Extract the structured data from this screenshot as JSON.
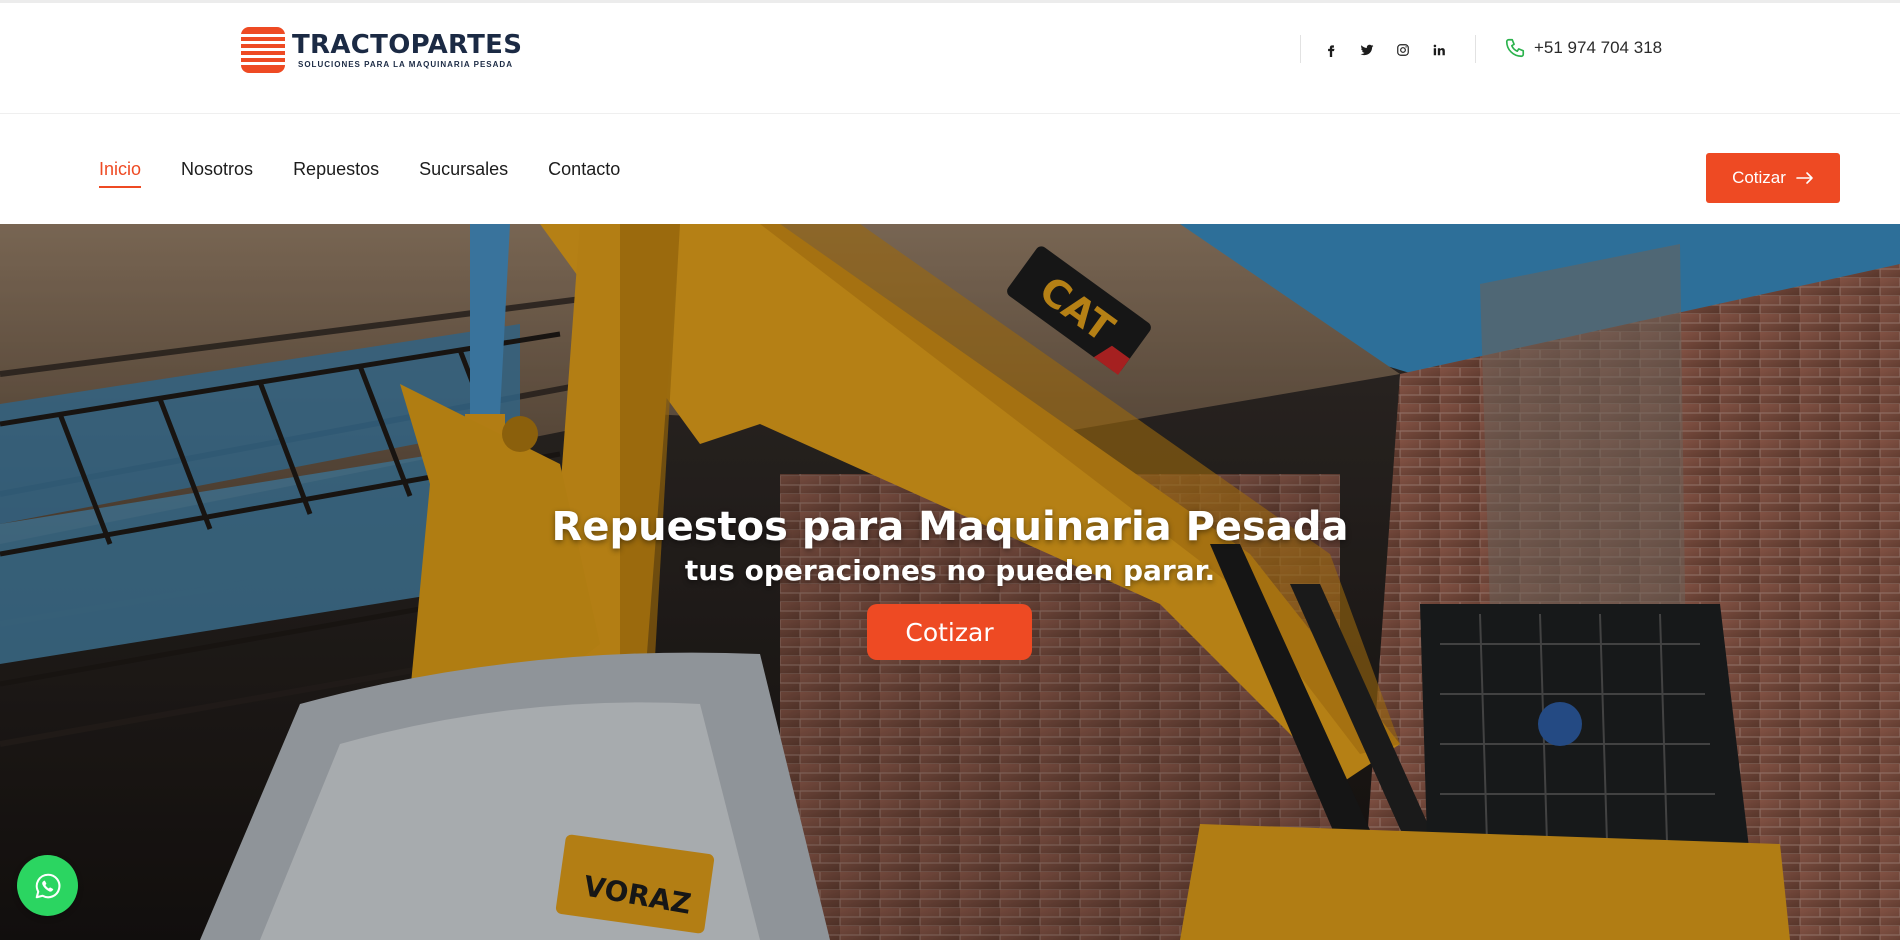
{
  "brand": {
    "name": "TRACTOPARTES",
    "tagline": "SOLUCIONES PARA LA MAQUINARIA PESADA",
    "accent_color": "#ee4a23",
    "dark_color": "#1b2a44"
  },
  "header": {
    "social_icons": [
      "facebook-icon",
      "twitter-icon",
      "instagram-icon",
      "linkedin-icon"
    ],
    "phone": "+51 974 704 318"
  },
  "nav": {
    "items": [
      {
        "label": "Inicio",
        "active": true
      },
      {
        "label": "Nosotros",
        "active": false
      },
      {
        "label": "Repuestos",
        "active": false
      },
      {
        "label": "Sucursales",
        "active": false
      },
      {
        "label": "Contacto",
        "active": false
      }
    ],
    "cta_label": "Cotizar"
  },
  "hero": {
    "title": "Repuestos para Maquinaria Pesada",
    "subtitle": "tus operaciones no pueden parar.",
    "cta_label": "Cotizar",
    "bucket_brand": "VORAZ",
    "machine_brand": "CAT"
  },
  "whatsapp": {
    "icon": "whatsapp-icon",
    "color": "#2bd561"
  }
}
